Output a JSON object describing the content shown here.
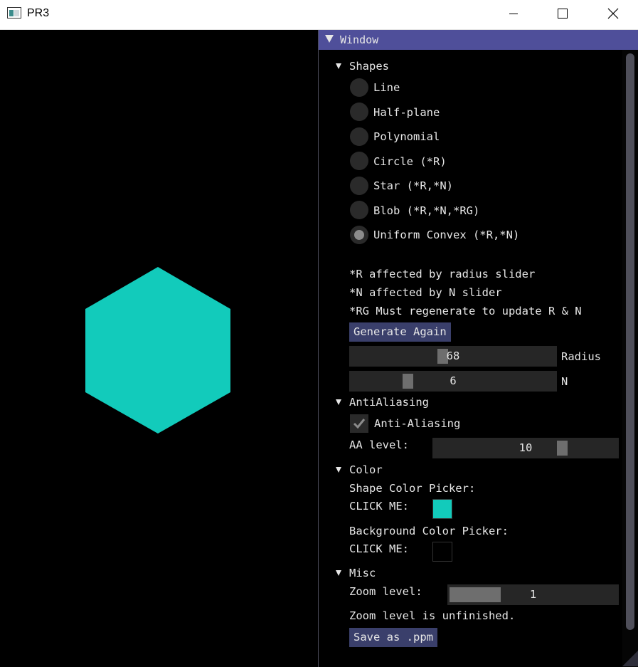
{
  "app": {
    "title": "PR3"
  },
  "colors": {
    "shape": "#12cbbb",
    "background": "#000000",
    "title_bar": "#4f4f9a",
    "button": "#3a3f6b"
  },
  "panel": {
    "title": "Window",
    "shapes": {
      "header": "Shapes",
      "options": [
        "Line",
        "Half-plane",
        "Polynomial",
        "Circle (*R)",
        "Star (*R,*N)",
        "Blob (*R,*N,*RG)",
        "Uniform Convex (*R,*N)"
      ],
      "selected_index": 6,
      "notes": [
        "*R affected by radius slider",
        "*N affected by N slider",
        "*RG Must regenerate to update R & N"
      ],
      "generate_button": "Generate Again",
      "radius": {
        "value": "68",
        "label": "Radius"
      },
      "n": {
        "value": "6",
        "label": "N"
      }
    },
    "antialiasing": {
      "header": "AntiAliasing",
      "checkbox_label": "Anti-Aliasing",
      "checked": true,
      "level_label": "AA level:",
      "level_value": "10"
    },
    "color": {
      "header": "Color",
      "shape_picker_label": "Shape Color Picker:",
      "shape_click": "CLICK ME:",
      "background_picker_label": "Background Color Picker:",
      "background_click": "CLICK ME:"
    },
    "misc": {
      "header": "Misc",
      "zoom_label": "Zoom level:",
      "zoom_value": "1",
      "zoom_note": "Zoom level is unfinished.",
      "save_button": "Save as .ppm"
    }
  }
}
